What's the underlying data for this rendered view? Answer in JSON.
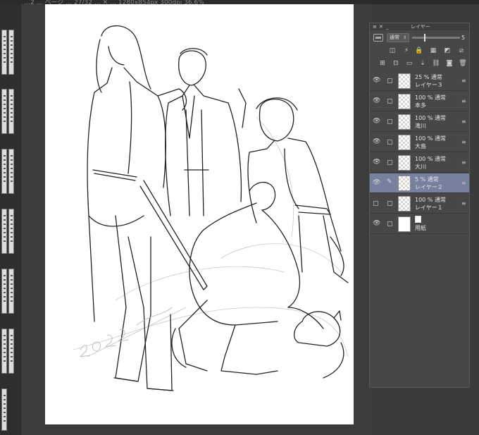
{
  "window": {
    "tab_label": "…2 … ページ … 27/32 … ✕ … 1280x854px 300dpi 36.6%"
  },
  "layer_panel": {
    "title": "レイヤー",
    "blend_mode": "通常",
    "opacity_value": "5",
    "opacity_fraction": 0.25,
    "layers": [
      {
        "opacity": "25 %",
        "mode": "通常",
        "name": "レイヤー３",
        "visible": true,
        "selected": false,
        "paper": false
      },
      {
        "opacity": "100 %",
        "mode": "通常",
        "name": "本多",
        "visible": true,
        "selected": false,
        "paper": false
      },
      {
        "opacity": "100 %",
        "mode": "通常",
        "name": "滝川",
        "visible": true,
        "selected": false,
        "paper": false
      },
      {
        "opacity": "100 %",
        "mode": "通常",
        "name": "大島",
        "visible": true,
        "selected": false,
        "paper": false
      },
      {
        "opacity": "100 %",
        "mode": "通常",
        "name": "大川",
        "visible": true,
        "selected": false,
        "paper": false
      },
      {
        "opacity": "5 %",
        "mode": "通常",
        "name": "レイヤー２",
        "visible": true,
        "selected": true,
        "paper": false
      },
      {
        "opacity": "100 %",
        "mode": "通常",
        "name": "レイヤー１",
        "visible": false,
        "selected": false,
        "paper": false
      },
      {
        "opacity": "",
        "mode": "",
        "name": "用紙",
        "visible": true,
        "selected": false,
        "paper": true
      }
    ]
  },
  "icons": {
    "eye": "👁",
    "pencil": "✎",
    "handle": "≡"
  }
}
